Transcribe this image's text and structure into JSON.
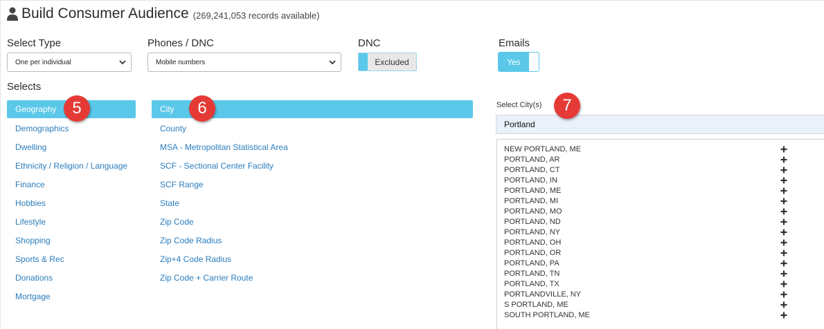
{
  "header": {
    "title": "Build Consumer Audience",
    "records": "(269,241,053 records available)"
  },
  "filters": {
    "select_type": {
      "label": "Select Type",
      "value": "One per individual"
    },
    "phones_dnc": {
      "label": "Phones / DNC",
      "value": "Mobile numbers"
    },
    "dnc": {
      "label": "DNC",
      "value": "Excluded"
    },
    "emails": {
      "label": "Emails",
      "value": "Yes"
    }
  },
  "selects_label": "Selects",
  "categories": [
    "Geography",
    "Demographics",
    "Dwelling",
    "Ethnicity / Religion / Language",
    "Finance",
    "Hobbies",
    "Lifestyle",
    "Shopping",
    "Sports & Rec",
    "Donations",
    "Mortgage"
  ],
  "geography_options": [
    "City",
    "County",
    "MSA - Metropolitan Statistical Area",
    "SCF - Sectional Center Facility",
    "SCF Range",
    "State",
    "Zip Code",
    "Zip Code Radius",
    "Zip+4 Code Radius",
    "Zip Code + Carrier Route"
  ],
  "city_panel": {
    "label": "Select City(s)",
    "search_value": "Portland",
    "results": [
      "NEW PORTLAND, ME",
      "PORTLAND, AR",
      "PORTLAND, CT",
      "PORTLAND, IN",
      "PORTLAND, ME",
      "PORTLAND, MI",
      "PORTLAND, MO",
      "PORTLAND, ND",
      "PORTLAND, NY",
      "PORTLAND, OH",
      "PORTLAND, OR",
      "PORTLAND, PA",
      "PORTLAND, TN",
      "PORTLAND, TX",
      "PORTLANDVILLE, NY",
      "S PORTLAND, ME",
      "SOUTH PORTLAND, ME"
    ]
  },
  "step_badges": [
    "5",
    "6",
    "7"
  ],
  "colors": {
    "accent": "#5bc8e9",
    "link": "#2a7dbd",
    "badge": "#e53935"
  },
  "icons": {
    "header": "user-icon",
    "select": "chevron-down-icon",
    "add": "plus-icon"
  }
}
